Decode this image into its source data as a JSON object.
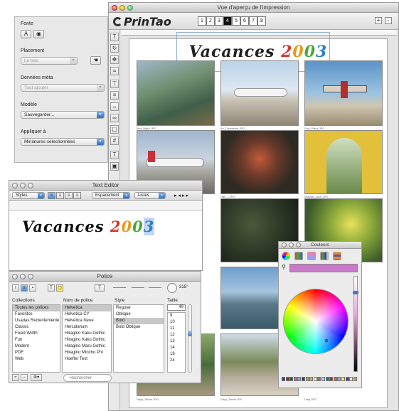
{
  "main_window": {
    "title": "Vue d'aperçu de l'impression",
    "logo": "PrinTao",
    "pages": [
      "1",
      "2",
      "3",
      "4",
      "5",
      "6",
      "7",
      "8"
    ],
    "active_page": "4",
    "zoom_in": "+",
    "zoom_out": "-",
    "page_title_parts": [
      "Vacances ",
      "2",
      "0",
      "0",
      "3"
    ],
    "captions": [
      "Bird_Night.JPG",
      "Air_Doubleton.JPG",
      "Sea_Plane.JPG",
      "Airport.JPG",
      "Hall_1.JPG",
      "Mosque_Arch.JPG",
      "Days_Street.JPG",
      "Days_Street.JPG",
      "Dadj.JPG"
    ],
    "tool_icons": [
      "text-tool-icon",
      "rotate-icon",
      "move-icon",
      "crop-icon",
      "align-top-icon",
      "align-middle-icon",
      "distribute-icon",
      "link-icon",
      "frame-icon",
      "grid-icon",
      "text-frame-icon",
      "photo-icon"
    ]
  },
  "inspector": {
    "fonts_label": "Fonte",
    "font_buttons": [
      "A",
      "◉"
    ],
    "placement_label": "Placement",
    "placement_value": "Le bas",
    "metadata_label": "Données méta",
    "metadata_value": "Tout ajouter",
    "model_label": "Modèle",
    "model_value": "Sauvegarder...",
    "apply_label": "Appliquer à",
    "apply_value": "Miniatures sélectionnées"
  },
  "text_editor": {
    "title": "Text Editor",
    "styles_label": "Styles",
    "spacing_label": "Espacement",
    "lists_label": "Listes",
    "text_parts": [
      "Vacances ",
      "2",
      "0",
      "0",
      "3"
    ]
  },
  "font_panel": {
    "title": "Police",
    "collections_header": "Collections",
    "family_header": "Nom de police",
    "style_header": "Style",
    "size_header": "Taille",
    "size_value": "49",
    "angle_value": "315°",
    "collections": [
      "Toutes les polices",
      "Favoritos",
      "Usadas Recientemente",
      "Classic",
      "Fixed Width",
      "Fun",
      "Modern",
      "PDF",
      "Web"
    ],
    "families": [
      "Helvetica",
      "Helvetica CY",
      "Helvetica Neue",
      "Herculanum",
      "Hiragino Kaku Gothic",
      "Hiragino Kaku Gothic",
      "Hiragino Maru Gothic",
      "Hiragino Mincho Pro",
      "Hoefler Text"
    ],
    "styles": [
      "Regular",
      "Oblique",
      "Bold",
      "Bold Oblique"
    ],
    "sizes": [
      "9",
      "10",
      "11",
      "12",
      "13",
      "14",
      "18",
      "24"
    ],
    "search_placeholder": "Rechercher",
    "add_label": "+",
    "remove_label": "−",
    "action_label": "⚙▾"
  },
  "color_window": {
    "title": "Couleurs",
    "current_color": "#c979c8",
    "swatches": [
      "#223a9a",
      "#9a1e1e",
      "#1a6a2a",
      "#b06ab0",
      "#8aa9d8",
      "#3a3a3a",
      "#a0a0a0",
      "#e0b050",
      "#ffffff",
      "#6b8e3a",
      "#c0c0ff",
      "#2a6aa8",
      "#7a4a2a",
      "#d06060",
      "#60c0c0",
      "#ffe070",
      "#404080",
      "#e8e8e8",
      "#c0a080"
    ]
  }
}
